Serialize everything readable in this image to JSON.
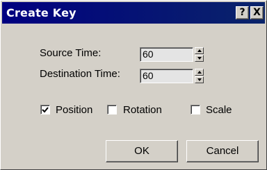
{
  "window": {
    "title": "Create Key",
    "help_glyph": "?",
    "close_glyph": "X"
  },
  "fields": {
    "source_time": {
      "label": "Source Time:",
      "value": "60"
    },
    "destination_time": {
      "label": "Destination Time:",
      "value": "60"
    }
  },
  "options": {
    "position": {
      "label": "Position",
      "checked": true
    },
    "rotation": {
      "label": "Rotation",
      "checked": false
    },
    "scale": {
      "label": "Scale",
      "checked": false
    }
  },
  "buttons": {
    "ok": "OK",
    "cancel": "Cancel"
  },
  "colors": {
    "dialog_face": "#d4d0c8",
    "titlebar": "#0a246a",
    "field_bg": "#e4e4e4"
  }
}
